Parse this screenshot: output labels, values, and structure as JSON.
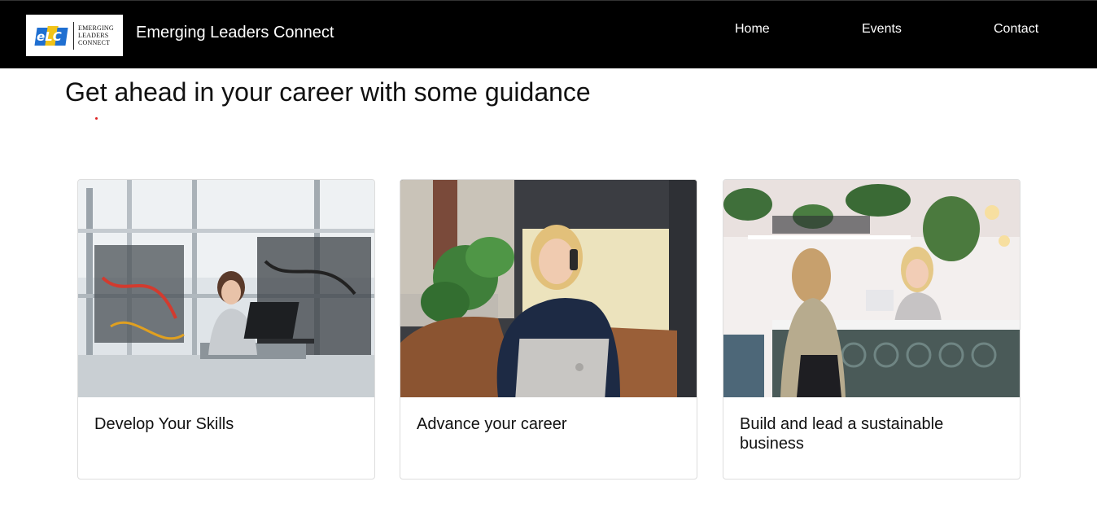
{
  "header": {
    "logo": {
      "mark_text": "eLC",
      "words": [
        "EMERGING",
        "LEADERS",
        "CONNECT"
      ]
    },
    "title": "Emerging Leaders Connect",
    "nav": [
      {
        "label": "Home"
      },
      {
        "label": "Events"
      },
      {
        "label": "Contact"
      }
    ]
  },
  "main": {
    "headline": "Get ahead in your career with some guidance",
    "cards": [
      {
        "title": "Develop Your Skills",
        "image": "engineer-at-laptop-photo"
      },
      {
        "title": "Advance your career",
        "image": "woman-on-phone-photo"
      },
      {
        "title": "Build and lead a sustainable business",
        "image": "cafe-counter-photo"
      }
    ]
  },
  "colors": {
    "navbar_bg": "#000000",
    "logo_blue": "#1f6fd1",
    "logo_yellow": "#f2c318",
    "accent_dot": "#dd2222"
  }
}
